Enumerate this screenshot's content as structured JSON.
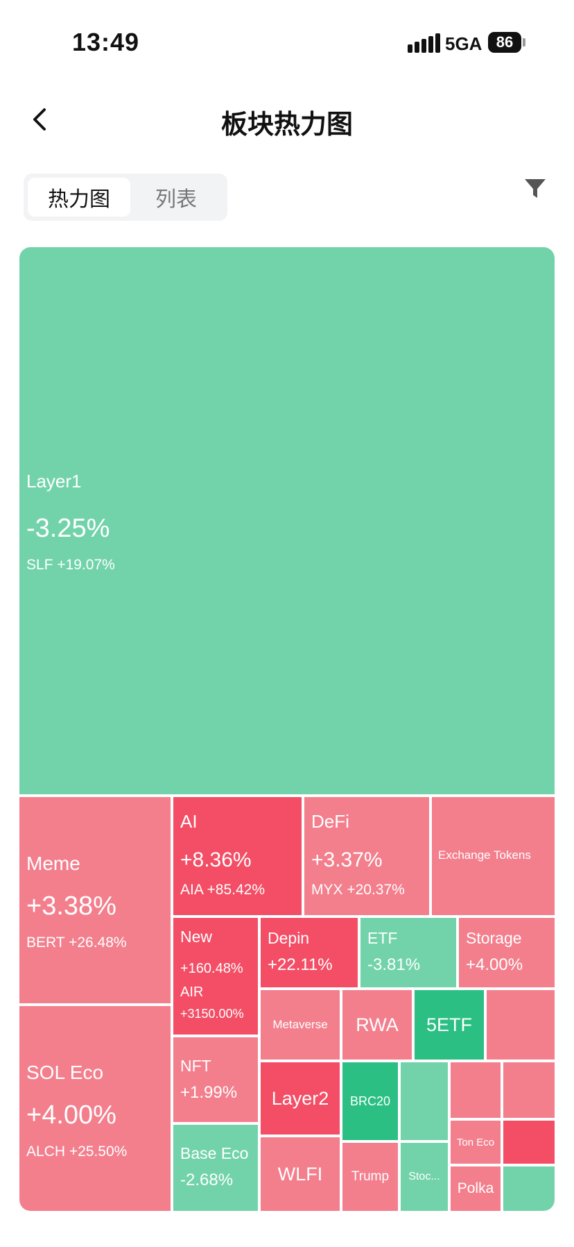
{
  "status": {
    "time": "13:49",
    "network": "5GA",
    "battery": "86"
  },
  "nav": {
    "title": "板块热力图"
  },
  "tabs": [
    {
      "label": "热力图"
    },
    {
      "label": "列表"
    }
  ],
  "tiles": {
    "layer1": {
      "name": "Layer1",
      "pct": "-3.25%",
      "top": "SLF +19.07%"
    },
    "meme": {
      "name": "Meme",
      "pct": "+3.38%",
      "top": "BERT +26.48%"
    },
    "sol": {
      "name": "SOL Eco",
      "pct": "+4.00%",
      "top": "ALCH +25.50%"
    },
    "ai": {
      "name": "AI",
      "pct": "+8.36%",
      "top": "AIA +85.42%"
    },
    "defi": {
      "name": "DeFi",
      "pct": "+3.37%",
      "top": "MYX +20.37%"
    },
    "exchange": {
      "name": "Exchange Tokens"
    },
    "new": {
      "name": "New",
      "pct": "+160.48%",
      "top1": "AIR",
      "top2": "+3150.00%"
    },
    "depin": {
      "name": "Depin",
      "pct": "+22.11%"
    },
    "etf": {
      "name": "ETF",
      "pct": "-3.81%"
    },
    "storage": {
      "name": "Storage",
      "pct": "+4.00%"
    },
    "nft": {
      "name": "NFT",
      "pct": "+1.99%"
    },
    "base": {
      "name": "Base Eco",
      "pct": "-2.68%"
    },
    "metaverse": {
      "name": "Metaverse"
    },
    "rwa": {
      "name": "RWA"
    },
    "etf5": {
      "name": "5ETF"
    },
    "layer2": {
      "name": "Layer2"
    },
    "brc20": {
      "name": "BRC20"
    },
    "wlfi": {
      "name": "WLFI"
    },
    "trump": {
      "name": "Trump"
    },
    "stoc": {
      "name": "Stoc..."
    },
    "ton": {
      "name": "Ton Eco"
    },
    "polka": {
      "name": "Polka"
    }
  }
}
